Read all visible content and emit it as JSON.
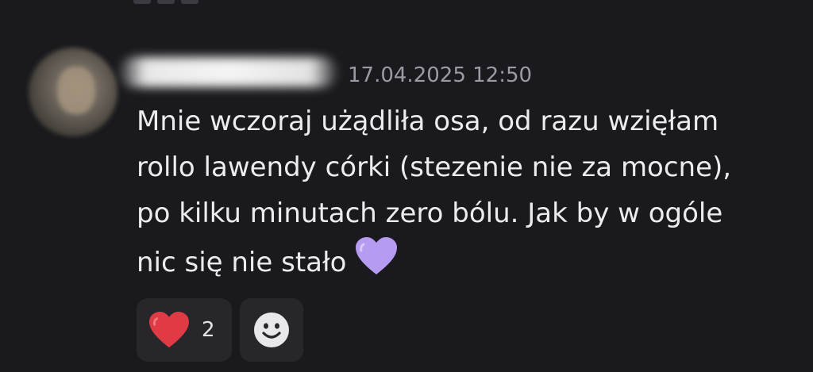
{
  "message": {
    "author_avatar_icon": "avatar-blurred",
    "timestamp": "17.04.2025 12:50",
    "lines": [
      "Mnie wczoraj użądliła osa, od razu wzięłam",
      "rollo lawendy córki (stezenie nie za mocne),",
      "po kilku minutach zero bólu. Jak by w ogóle",
      "nic się nie stało"
    ],
    "inline_emoji": "purple-heart-icon",
    "reactions": [
      {
        "icon": "red-heart-icon",
        "count": "2"
      }
    ],
    "add_reaction_icon": "smiley-face-icon"
  },
  "colors": {
    "background": "#1a1a1e",
    "chip": "#26262b",
    "text": "#ececee",
    "timestamp": "#9b9ba3",
    "purple_heart": "#b59cf0",
    "red_heart": "#e03a44"
  }
}
